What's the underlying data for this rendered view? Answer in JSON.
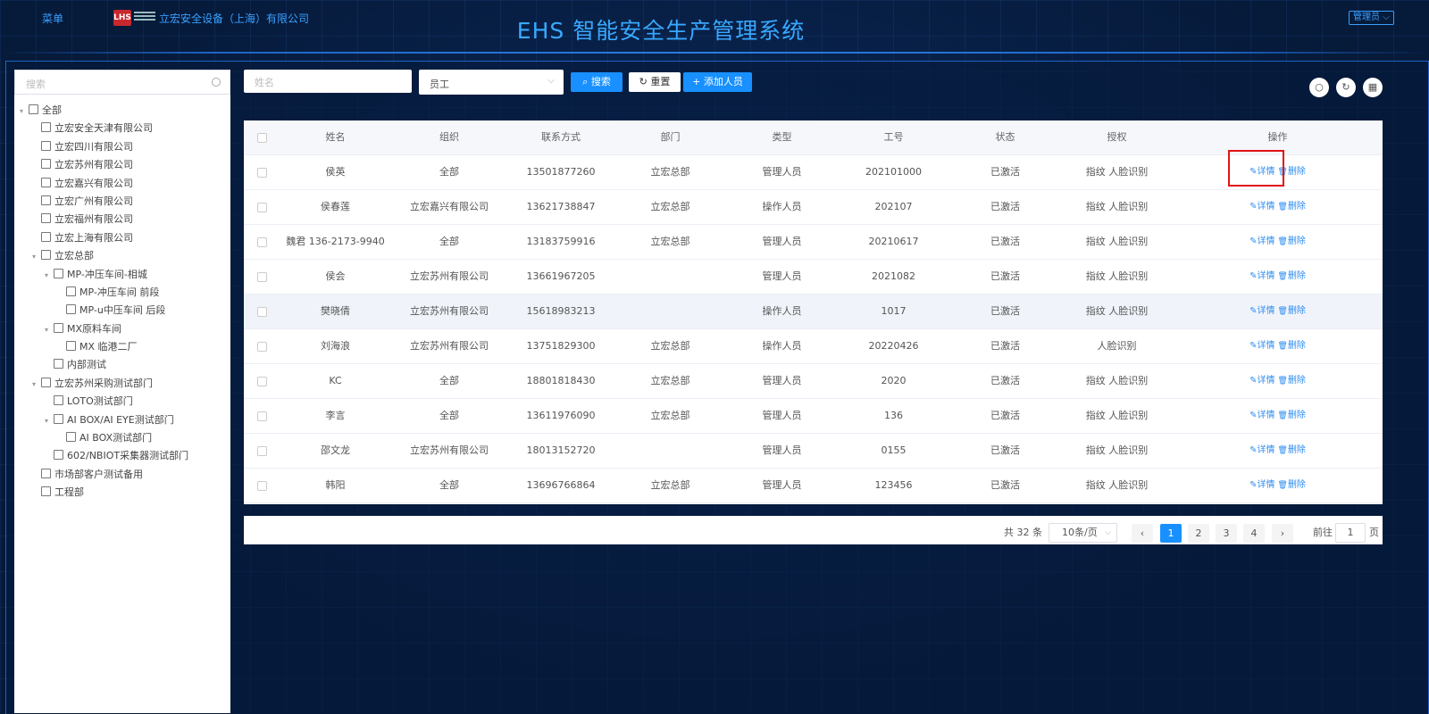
{
  "header": {
    "menu": "菜单",
    "logo_text": "LHS",
    "company": "立宏安全设备（上海）有限公司",
    "system_title": "EHS 智能安全生产管理系统",
    "user_menu": "管理员 ⌵"
  },
  "sidebar": {
    "search_placeholder": "搜索",
    "tree": [
      {
        "label": "全部",
        "level": 0,
        "expand": "▾",
        "icon": "folder"
      },
      {
        "label": "立宏安全天津有限公司",
        "level": 1,
        "expand": "",
        "icon": "folder"
      },
      {
        "label": "立宏四川有限公司",
        "level": 1,
        "expand": "",
        "icon": "folder"
      },
      {
        "label": "立宏苏州有限公司",
        "level": 1,
        "expand": "",
        "icon": "folder"
      },
      {
        "label": "立宏嘉兴有限公司",
        "level": 1,
        "expand": "",
        "icon": "folder"
      },
      {
        "label": "立宏广州有限公司",
        "level": 1,
        "expand": "",
        "icon": "folder"
      },
      {
        "label": "立宏福州有限公司",
        "level": 1,
        "expand": "",
        "icon": "folder"
      },
      {
        "label": "立宏上海有限公司",
        "level": 1,
        "expand": "",
        "icon": "folder"
      },
      {
        "label": "立宏总部",
        "level": 1,
        "expand": "▾",
        "icon": "doc"
      },
      {
        "label": "MP-冲压车间-相城",
        "level": 2,
        "expand": "▾",
        "icon": "doc"
      },
      {
        "label": "MP-冲压车间 前段",
        "level": 3,
        "expand": "",
        "icon": "doc"
      },
      {
        "label": "MP-u中压车间 后段",
        "level": 3,
        "expand": "",
        "icon": "doc"
      },
      {
        "label": "MX原料车间",
        "level": 2,
        "expand": "▾",
        "icon": "doc"
      },
      {
        "label": "MX 临港二厂",
        "level": 3,
        "expand": "",
        "icon": "doc"
      },
      {
        "label": "内部测试",
        "level": 2,
        "expand": "",
        "icon": "doc"
      },
      {
        "label": "立宏苏州采购测试部门",
        "level": 1,
        "expand": "▾",
        "icon": "doc"
      },
      {
        "label": "LOTO测试部门",
        "level": 2,
        "expand": "",
        "icon": "doc"
      },
      {
        "label": "AI BOX/AI EYE测试部门",
        "level": 2,
        "expand": "▾",
        "icon": "doc"
      },
      {
        "label": "AI BOX测试部门",
        "level": 3,
        "expand": "",
        "icon": "doc"
      },
      {
        "label": "602/NBIOT采集器测试部门",
        "level": 2,
        "expand": "",
        "icon": "doc"
      },
      {
        "label": "市场部客户测试备用",
        "level": 1,
        "expand": "",
        "icon": "doc"
      },
      {
        "label": "工程部",
        "level": 1,
        "expand": "",
        "icon": "doc"
      }
    ]
  },
  "toolbar": {
    "name_placeholder": "姓名",
    "type_select": "员工",
    "search_btn": "搜索",
    "reset_btn": "重置",
    "add_btn": "添加人员"
  },
  "table": {
    "columns": [
      "姓名",
      "组织",
      "联系方式",
      "部门",
      "类型",
      "工号",
      "状态",
      "授权",
      "操作"
    ],
    "rows": [
      [
        "侯英",
        "全部",
        "13501877260",
        "立宏总部",
        "管理人员",
        "202101000",
        "已激活",
        "指纹 人脸识别"
      ],
      [
        "侯春莲",
        "立宏嘉兴有限公司",
        "13621738847",
        "立宏总部",
        "操作人员",
        "202107",
        "已激活",
        "指纹 人脸识别"
      ],
      [
        "魏君 136-2173-9940",
        "全部",
        "13183759916",
        "立宏总部",
        "管理人员",
        "20210617",
        "已激活",
        "指纹 人脸识别"
      ],
      [
        "侯会",
        "立宏苏州有限公司",
        "13661967205",
        "",
        "管理人员",
        "2021082",
        "已激活",
        "指纹 人脸识别"
      ],
      [
        "樊晓倩",
        "立宏苏州有限公司",
        "15618983213",
        "",
        "操作人员",
        "1017",
        "已激活",
        "指纹 人脸识别"
      ],
      [
        "刘海浪",
        "立宏苏州有限公司",
        "13751829300",
        "立宏总部",
        "操作人员",
        "20220426",
        "已激活",
        "人脸识别"
      ],
      [
        "KC",
        "全部",
        "18801818430",
        "立宏总部",
        "管理人员",
        "2020",
        "已激活",
        "指纹 人脸识别"
      ],
      [
        "李言",
        "全部",
        "13611976090",
        "立宏总部",
        "管理人员",
        "136",
        "已激活",
        "指纹 人脸识别"
      ],
      [
        "邵文龙",
        "立宏苏州有限公司",
        "18013152720",
        "",
        "管理人员",
        "0155",
        "已激活",
        "指纹 人脸识别"
      ],
      [
        "韩阳",
        "全部",
        "13696766864",
        "立宏总部",
        "管理人员",
        "123456",
        "已激活",
        "指纹 人脸识别"
      ]
    ],
    "detail_label": "详情",
    "delete_label": "删除"
  },
  "pagination": {
    "total": "共 32 条",
    "page_size": "10条/页",
    "pages": [
      "1",
      "2",
      "3",
      "4"
    ],
    "prev": "‹",
    "next": "›",
    "goto_label": "前往",
    "goto_value": "1",
    "page_unit": "页"
  },
  "colors": {
    "accent": "#1890ff",
    "title_blue": "#38a8ff",
    "background": "#061a3a",
    "highlight_box": "#e01414"
  }
}
